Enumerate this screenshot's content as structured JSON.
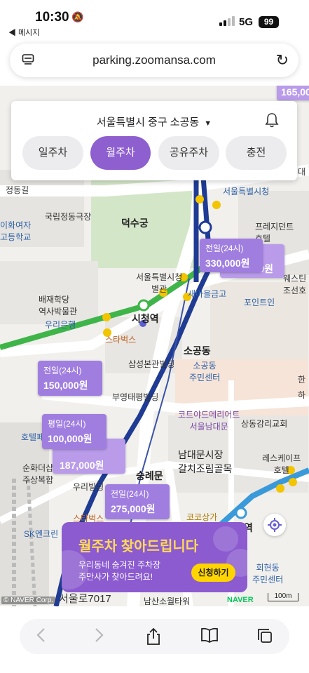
{
  "status_bar": {
    "time": "10:30",
    "back_label": "◀ 메시지",
    "network": "5G",
    "battery": "99"
  },
  "browser": {
    "url": "parking.zoomansa.com"
  },
  "filter": {
    "location": "서울특별시 중구 소공동",
    "tabs": [
      {
        "label": "일주차",
        "active": false
      },
      {
        "label": "월주차",
        "active": true
      },
      {
        "label": "공유주차",
        "active": false
      },
      {
        "label": "충전",
        "active": false
      }
    ]
  },
  "map_labels": {
    "jeongdong_gil": "정동길",
    "ewha": "이화여자\n고등학교",
    "gukrip": "국립정동극장",
    "deoksugung": "덕수궁",
    "seoul_city_hall": "서울특별시청",
    "prescient": "프레지던트\n호텔",
    "pai": "배재학당\n역사박물관",
    "city_annex": "서울특별시청\n별관",
    "westin": "웨스틴\n조선호",
    "woori_bank": "우리은행",
    "saemaul": "새마을금고",
    "pointin": "포인트인",
    "sicheong_station": "시청역",
    "starbucks1": "스타벅스",
    "sogong_dong": "소공동",
    "samsung": "삼성본관빌딩",
    "sogong_center": "소공동\n주민센터",
    "buyoung": "부영태평빌딩",
    "courtyard": "코트야드메리어트\n서울남대문",
    "sangdong": "상동감리교회",
    "namdaemun": "남대문시장\n갈치조림골목",
    "hotel_pe": "호텔페",
    "sunhwa": "순화더샵\n주상복합",
    "sungnyemun": "숭례문",
    "woori_bldg": "우리빌딩",
    "legacy": "레스케이프\n호텔",
    "starbucks2": "스타벅스",
    "sk_enclean": "SK엔크린",
    "cocosangga": "코코상가",
    "seoullo": "서울로7017",
    "namsan_tower": "남산소월타워",
    "hoehyeon": "회현동\n주민센터",
    "price_corner": "165,00",
    "station_short": "역",
    "han": "한",
    "ha": "하",
    "dae": "대"
  },
  "price_tags": [
    {
      "period": "전일(24시)",
      "price": "330,000원"
    },
    {
      "period": "",
      "price": "0원"
    },
    {
      "period": "전일(24시)",
      "price": "150,000원"
    },
    {
      "period": "평일(24시)",
      "price": "100,000원"
    },
    {
      "period": "",
      "price": "187,000원"
    },
    {
      "period": "전일(24시)",
      "price": "275,000원"
    }
  ],
  "banner": {
    "title": "월주차 찾아드립니다",
    "subtitle_line1": "우리동네 숨겨진 주차장",
    "subtitle_line2": "주만사가 찾아드려요!",
    "button": "신청하기"
  },
  "map_footer": {
    "naver": "NAVER",
    "scale": "100m",
    "copyright": "© NAVER Corp."
  },
  "colors": {
    "accent": "#8e5fcf",
    "tag": "#a07ee0",
    "banner_title": "#ffd95a",
    "cta": "#ffd400",
    "line1": "#1f3b93",
    "line2": "#3fb549",
    "line4": "#3a9ad9"
  }
}
